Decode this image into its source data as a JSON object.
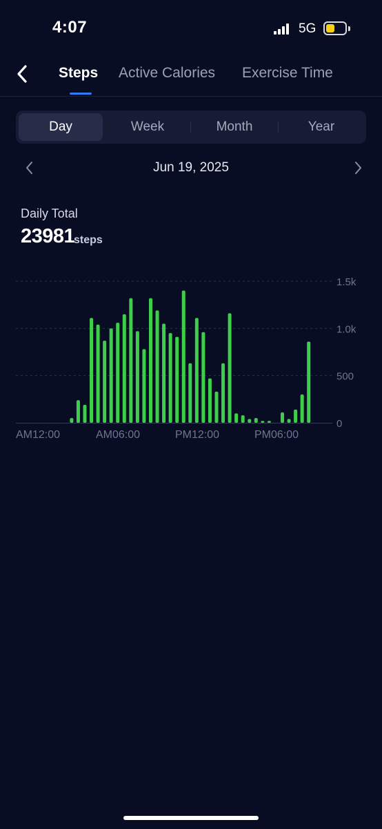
{
  "status_bar": {
    "time": "4:07",
    "network": "5G",
    "battery_color": "#f7d117",
    "signal_icon": "signal-bars-icon",
    "battery_icon": "battery-icon"
  },
  "header": {
    "back_icon": "chevron-left-icon",
    "tabs": [
      {
        "label": "Steps",
        "active": true
      },
      {
        "label": "Active Calories",
        "active": false
      },
      {
        "label": "Exercise Time",
        "active": false
      }
    ],
    "accent_color": "#2f7cf6"
  },
  "range_selector": {
    "options": [
      "Day",
      "Week",
      "Month",
      "Year"
    ],
    "selected": "Day"
  },
  "date_nav": {
    "label": "Jun 19, 2025",
    "prev_icon": "chevron-left-icon",
    "next_icon": "chevron-right-icon"
  },
  "summary": {
    "label": "Daily Total",
    "value": "23981",
    "unit": "steps"
  },
  "chart_data": {
    "type": "bar",
    "bar_color": "#3ecf4a",
    "x_tick_labels": [
      "AM12:00",
      "AM06:00",
      "PM12:00",
      "PM06:00"
    ],
    "y_tick_labels": [
      "1.5k",
      "1.0k",
      "500",
      "0"
    ],
    "ylim": [
      0,
      1500
    ],
    "y_ticks": [
      1500,
      1000,
      500,
      0
    ],
    "grid": true,
    "categories": [
      "00:00",
      "00:30",
      "01:00",
      "01:30",
      "02:00",
      "02:30",
      "03:00",
      "03:30",
      "04:00",
      "04:30",
      "05:00",
      "05:30",
      "06:00",
      "06:30",
      "07:00",
      "07:30",
      "08:00",
      "08:30",
      "09:00",
      "09:30",
      "10:00",
      "10:30",
      "11:00",
      "11:30",
      "12:00",
      "12:30",
      "13:00",
      "13:30",
      "14:00",
      "14:30",
      "15:00",
      "15:30",
      "16:00",
      "16:30",
      "17:00",
      "17:30",
      "18:00",
      "18:30",
      "19:00",
      "19:30",
      "20:00",
      "20:30",
      "21:00",
      "21:30",
      "22:00",
      "22:30",
      "23:00",
      "23:30"
    ],
    "values": [
      0,
      0,
      0,
      0,
      0,
      0,
      0,
      0,
      50,
      240,
      190,
      1110,
      1040,
      870,
      1000,
      1060,
      1150,
      1320,
      970,
      780,
      1320,
      1190,
      1050,
      950,
      910,
      1400,
      630,
      1110,
      960,
      470,
      330,
      630,
      1160,
      100,
      80,
      40,
      50,
      20,
      20,
      0,
      110,
      40,
      140,
      300,
      860,
      0,
      0,
      0
    ]
  }
}
